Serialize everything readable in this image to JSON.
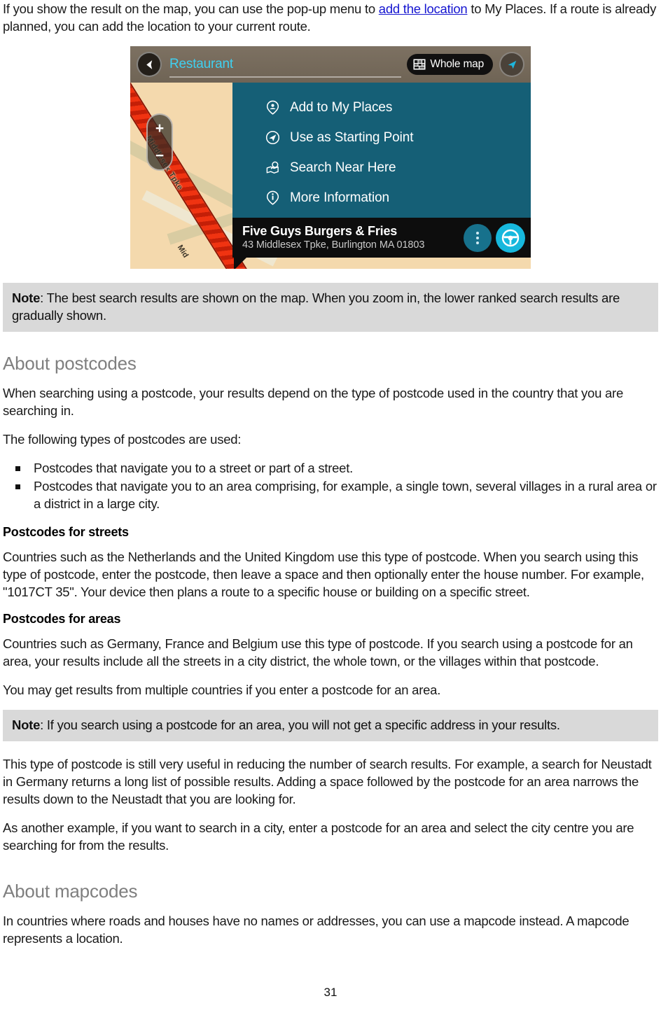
{
  "intro": {
    "before_link": "If you show the result on the map, you can use the pop-up menu to ",
    "link_text": "add the location",
    "after_link": " to My Places. If a route is already planned, you can add the location to your current route."
  },
  "device": {
    "back_icon": "back-arrow-icon",
    "search_query": "Restaurant",
    "whole_map_label": "Whole map",
    "whole_map_icon": "map-grid-icon",
    "compass_icon": "navigation-arrow-icon",
    "zoom_in_label": "+",
    "zoom_out_label": "−",
    "map_labels": {
      "street_primary": "Middlesex Tpke",
      "street_secondary": "Mid"
    },
    "menu_items": [
      {
        "icon": "place-pin-icon",
        "label": "Add to My Places"
      },
      {
        "icon": "start-point-icon",
        "label": "Use as Starting Point"
      },
      {
        "icon": "search-near-icon",
        "label": "Search Near Here"
      },
      {
        "icon": "info-icon",
        "label": "More Information"
      }
    ],
    "result": {
      "title": "Five Guys Burgers & Fries",
      "address": "43 Middlesex Tpke, Burlington MA 01803",
      "more_options_icon": "kebab-menu-icon",
      "drive_icon": "steering-wheel-icon"
    }
  },
  "note_1": {
    "lead": "Note",
    "text": ": The best search results are shown on the map. When you zoom in, the lower ranked search results are gradually shown."
  },
  "postcodes": {
    "heading": "About postcodes",
    "para_1": "When searching using a postcode, your results depend on the type of postcode used in the country that you are searching in.",
    "para_2": "The following types of postcodes are used:",
    "bullets": [
      "Postcodes that navigate you to a street or part of a street.",
      "Postcodes that navigate you to an area comprising, for example, a single town, several villages in a rural area or a district in a large city."
    ],
    "streets": {
      "heading": "Postcodes for streets",
      "para": "Countries such as the Netherlands and the United Kingdom use this type of postcode. When you search using this type of postcode, enter the postcode, then leave a space and then optionally enter the house number. For example, \"1017CT 35\". Your device then plans a route to a specific house or building on a specific street."
    },
    "areas": {
      "heading": "Postcodes for areas",
      "para_1": "Countries such as Germany, France and Belgium use this type of postcode. If you search using a postcode for an area, your results include all the streets in a city district, the whole town, or the villages within that postcode.",
      "para_2": "You may get results from multiple countries if you enter a postcode for an area."
    }
  },
  "note_2": {
    "lead": "Note",
    "text": ": If you search using a postcode for an area, you will not get a specific address in your results."
  },
  "after_note": {
    "para_1": "This type of postcode is still very useful in reducing the number of search results. For example, a search for Neustadt in Germany returns a long list of possible results. Adding a space followed by the postcode for an area narrows the results down to the Neustadt that you are looking for.",
    "para_2": "As another example, if you want to search in a city, enter a postcode for an area and select the city centre you are searching for from the results."
  },
  "mapcodes": {
    "heading": "About mapcodes",
    "para": "In countries where roads and houses have no names or addresses, you can use a mapcode instead. A mapcode represents a location."
  },
  "footer": {
    "page_number": "31"
  },
  "colors": {
    "link": "#1515d0",
    "heading": "#7f7f7f",
    "note_bg": "#d9d9d9",
    "menu_teal": "#155f76",
    "accent_cyan": "#2bbfe4",
    "map_beige": "#f4d9ad"
  }
}
